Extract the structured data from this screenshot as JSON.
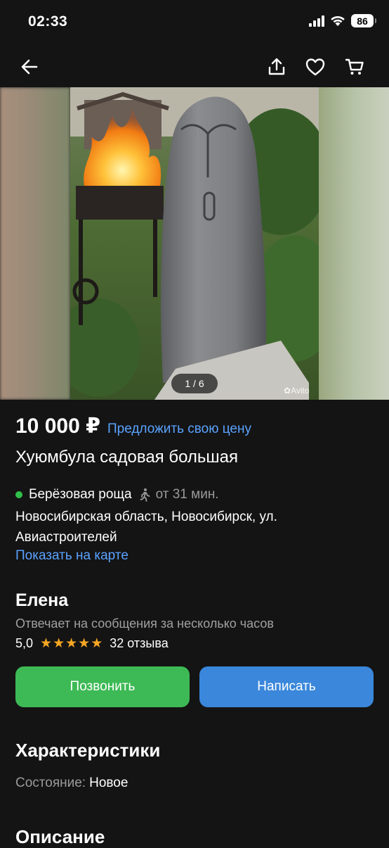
{
  "status_bar": {
    "time": "02:33",
    "battery": "86"
  },
  "nav": {
    "back_icon": "arrow-left-icon",
    "share_icon": "share-icon",
    "favorite_icon": "heart-icon",
    "cart_icon": "cart-icon"
  },
  "gallery": {
    "counter": "1 / 6",
    "watermark": "Avito"
  },
  "listing": {
    "price": "10 000 ₽",
    "offer_link": "Предложить свою цену",
    "title": "Хуюмбула садовая большая",
    "metro_station": "Берёзовая роща",
    "walk_time": "от 31 мин.",
    "address": "Новосибирская область, Новосибирск, ул. Авиастроителей",
    "map_link": "Показать на карте"
  },
  "seller": {
    "name": "Елена",
    "response_time": "Отвечает на сообщения за несколько часов",
    "rating": "5,0",
    "rating_stars": 5,
    "reviews": "32 отзыва"
  },
  "actions": {
    "call_label": "Позвонить",
    "write_label": "Написать"
  },
  "characteristics": {
    "title": "Характеристики",
    "items": [
      {
        "label": "Состояние:",
        "value": "Новое"
      }
    ]
  },
  "description": {
    "title": "Описание"
  },
  "colors": {
    "background": "#141414",
    "link": "#5aa2ff",
    "call_button": "#3dba55",
    "write_button": "#3a87db",
    "star": "#f5a623",
    "metro_dot": "#2fbf4a"
  }
}
